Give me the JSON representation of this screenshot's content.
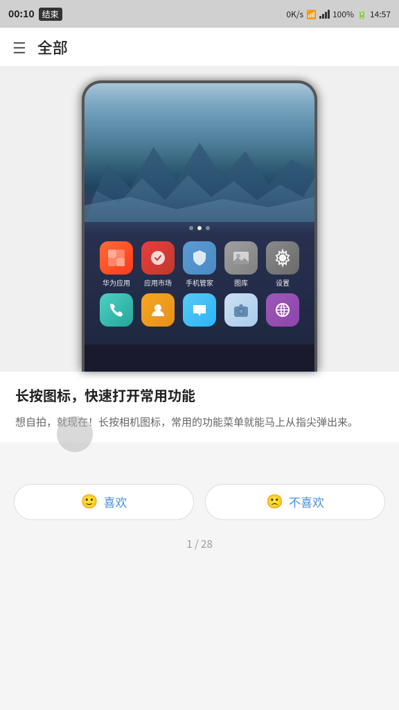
{
  "statusBar": {
    "time": "00:10",
    "callLabel": "结束",
    "network": "0K/s",
    "battery": "100%",
    "clockRight": "14:57"
  },
  "topNav": {
    "title": "全部"
  },
  "phoneScreen": {
    "dots": [
      false,
      true,
      false
    ],
    "apps": [
      [
        {
          "icon": "huawei",
          "label": "华为应用"
        },
        {
          "icon": "market",
          "label": "应用市场"
        },
        {
          "icon": "security",
          "label": "手机管家"
        },
        {
          "icon": "gallery",
          "label": "图库"
        },
        {
          "icon": "settings",
          "label": "设置"
        }
      ],
      [
        {
          "icon": "phone",
          "label": ""
        },
        {
          "icon": "contacts",
          "label": ""
        },
        {
          "icon": "messages",
          "label": ""
        },
        {
          "icon": "camera",
          "label": ""
        },
        {
          "icon": "browser",
          "label": ""
        }
      ]
    ]
  },
  "feature": {
    "title": "长按图标，快速打开常用功能",
    "description": "想自拍，就现在！长按相机图标，常用的功能菜单就能马上从指尖弹出来。"
  },
  "actions": {
    "likeEmoji": "🙂",
    "likeLabel": "喜欢",
    "dislikeEmoji": "🙁",
    "dislikeLabel": "不喜欢"
  },
  "pagination": {
    "current": "1",
    "total": "28",
    "separator": " / "
  }
}
